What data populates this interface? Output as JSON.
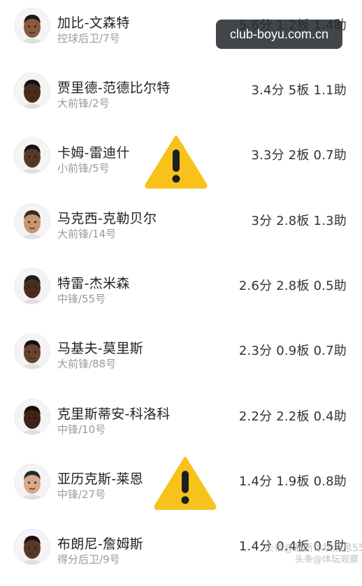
{
  "watermark_badge": "club-boyu.com.cn",
  "players": [
    {
      "name": "加比-文森特",
      "position": "控球后卫/7号",
      "stats": "5.6分 1.2板 1.4助",
      "skin": "#8a5a3c",
      "hair": "#1a1a1a"
    },
    {
      "name": "贾里德-范德比尔特",
      "position": "大前锋/2号",
      "stats": "3.4分 5板 1.1助",
      "skin": "#4a2c1e",
      "hair": "#111111"
    },
    {
      "name": "卡姆-雷迪什",
      "position": "小前锋/5号",
      "stats": "3.3分 2板 0.7助",
      "skin": "#5a3626",
      "hair": "#111111"
    },
    {
      "name": "马克西-克勒贝尔",
      "position": "大前锋/14号",
      "stats": "3分 2.8板 1.3助",
      "skin": "#c9946e",
      "hair": "#3a2a20"
    },
    {
      "name": "特雷-杰米森",
      "position": "中锋/55号",
      "stats": "2.6分 2.8板 0.5助",
      "skin": "#4a2b1c",
      "hair": "#1a1a1a"
    },
    {
      "name": "马基夫-莫里斯",
      "position": "大前锋/88号",
      "stats": "2.3分 0.9板 0.7助",
      "skin": "#6a4230",
      "hair": "#111111"
    },
    {
      "name": "克里斯蒂安-科洛科",
      "position": "中锋/10号",
      "stats": "2.2分 2.2板 0.4助",
      "skin": "#3e2418",
      "hair": "#111111"
    },
    {
      "name": "亚历克斯-莱恩",
      "position": "中锋/27号",
      "stats": "1.4分 1.9板 0.8助",
      "skin": "#d8a888",
      "hair": "#2e2a26"
    },
    {
      "name": "布朗尼-詹姆斯",
      "position": "得分后卫/9号",
      "stats": "1.4分 0.4板 0.5助",
      "skin": "#5a3828",
      "hair": "#111111"
    }
  ],
  "watermark_bottom": "头条@最新体坛消息55",
  "watermark_bottom2": "头条@体坛观察",
  "colors": {
    "warning": "#f7c21b",
    "badge_bg": "#2c3036"
  },
  "icons": [
    "avatar",
    "warning-icon"
  ]
}
